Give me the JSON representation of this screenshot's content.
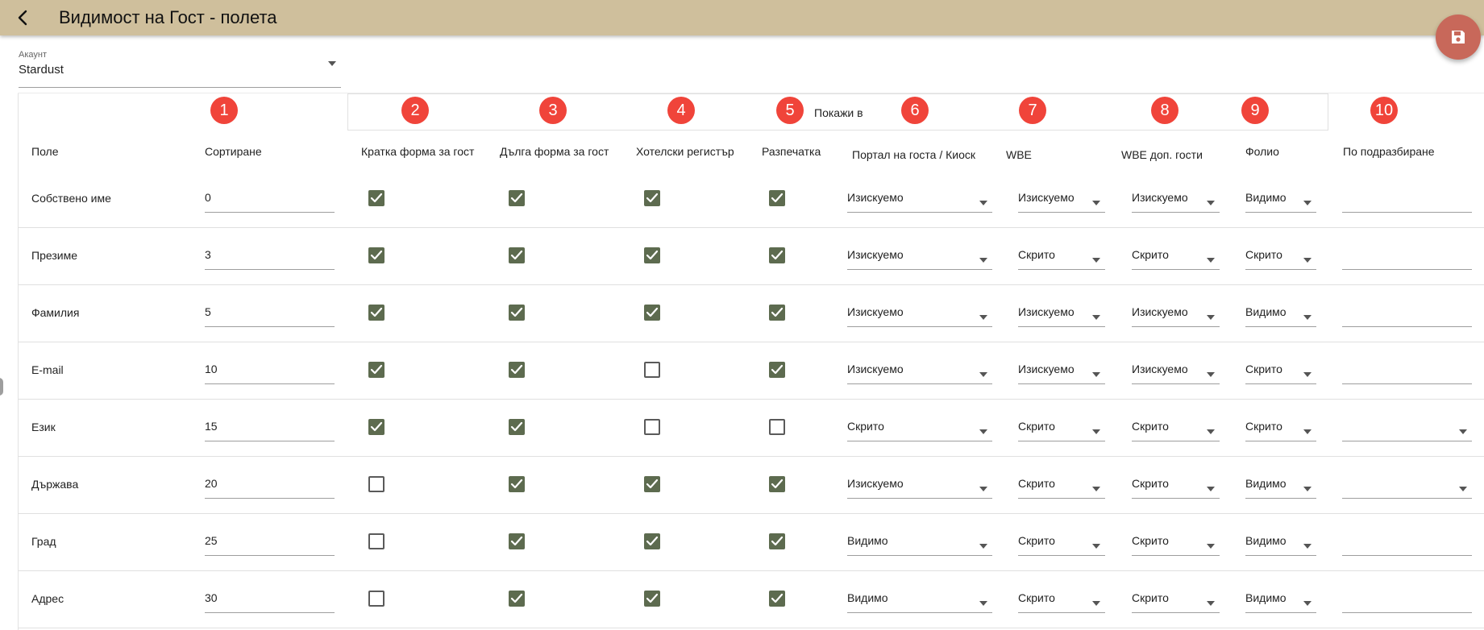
{
  "header": {
    "title": "Видимост на Гост - полета"
  },
  "account": {
    "label": "Акаунт",
    "value": "Stardust"
  },
  "show_in_label": "Покажи в",
  "badges": [
    "1",
    "2",
    "3",
    "4",
    "5",
    "6",
    "7",
    "8",
    "9",
    "10"
  ],
  "columns": {
    "field": "Поле",
    "sort": "Сортиране",
    "short_form": "Кратка форма за гост",
    "long_form": "Дълга форма за гост",
    "hotel_register": "Хотелски регистър",
    "printout": "Разпечатка",
    "portal": "Портал на госта / Киоск",
    "wbe": "WBE",
    "wbe_extra": "WBE доп. гости",
    "folio": "Фолио",
    "default": "По подразбиране"
  },
  "rows": [
    {
      "field": "Собствено име",
      "sort": "0",
      "short_form": true,
      "long_form": true,
      "hotel_register": true,
      "printout": true,
      "portal": "Изискуемо",
      "wbe": "Изискуемо",
      "wbe_extra": "Изискуемо",
      "folio": "Видимо",
      "default": "",
      "default_has_dropdown": false
    },
    {
      "field": "Презиме",
      "sort": "3",
      "short_form": true,
      "long_form": true,
      "hotel_register": true,
      "printout": true,
      "portal": "Изискуемо",
      "wbe": "Скрито",
      "wbe_extra": "Скрито",
      "folio": "Скрито",
      "default": "",
      "default_has_dropdown": false
    },
    {
      "field": "Фамилия",
      "sort": "5",
      "short_form": true,
      "long_form": true,
      "hotel_register": true,
      "printout": true,
      "portal": "Изискуемо",
      "wbe": "Изискуемо",
      "wbe_extra": "Изискуемо",
      "folio": "Видимо",
      "default": "",
      "default_has_dropdown": false
    },
    {
      "field": "E-mail",
      "sort": "10",
      "short_form": true,
      "long_form": true,
      "hotel_register": false,
      "printout": true,
      "portal": "Изискуемо",
      "wbe": "Изискуемо",
      "wbe_extra": "Изискуемо",
      "folio": "Скрито",
      "default": "",
      "default_has_dropdown": false
    },
    {
      "field": "Език",
      "sort": "15",
      "short_form": true,
      "long_form": true,
      "hotel_register": false,
      "printout": false,
      "portal": "Скрито",
      "wbe": "Скрито",
      "wbe_extra": "Скрито",
      "folio": "Скрито",
      "default": "",
      "default_has_dropdown": true
    },
    {
      "field": "Държава",
      "sort": "20",
      "short_form": false,
      "long_form": true,
      "hotel_register": true,
      "printout": true,
      "portal": "Изискуемо",
      "wbe": "Скрито",
      "wbe_extra": "Скрито",
      "folio": "Видимо",
      "default": "",
      "default_has_dropdown": true
    },
    {
      "field": "Град",
      "sort": "25",
      "short_form": false,
      "long_form": true,
      "hotel_register": true,
      "printout": true,
      "portal": "Видимо",
      "wbe": "Скрито",
      "wbe_extra": "Скрито",
      "folio": "Видимо",
      "default": "",
      "default_has_dropdown": false
    },
    {
      "field": "Адрес",
      "sort": "30",
      "short_form": false,
      "long_form": true,
      "hotel_register": true,
      "printout": true,
      "portal": "Видимо",
      "wbe": "Скрито",
      "wbe_extra": "Скрито",
      "folio": "Видимо",
      "default": "",
      "default_has_dropdown": false
    }
  ],
  "colors": {
    "appbar": "#cfbf9c",
    "fab": "#c8685a",
    "badge": "#f0443a",
    "checkbox_checked": "#5d6b4f"
  },
  "icons": {
    "back": "chevron-left-icon",
    "save": "floppy-disk-icon",
    "dropdown": "caret-down-icon",
    "check": "checkmark-icon"
  }
}
